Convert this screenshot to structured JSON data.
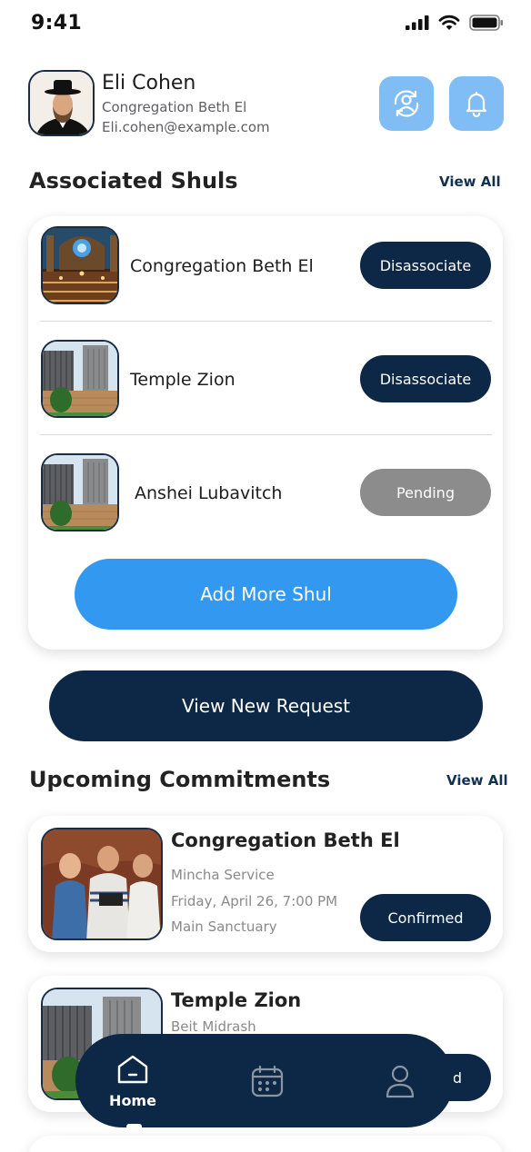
{
  "status_bar": {
    "time": "9:41"
  },
  "profile": {
    "name": "Eli Cohen",
    "shul": "Congregation Beth El",
    "email": "Eli.cohen@example.com"
  },
  "associated_shuls": {
    "title": "Associated Shuls",
    "view_all": "View All",
    "items": [
      {
        "name": "Congregation Beth El",
        "action": "Disassociate"
      },
      {
        "name": "Temple Zion",
        "action": "Disassociate"
      },
      {
        "name": "Anshei Lubavitch",
        "action": "Pending"
      }
    ],
    "add_button": "Add More Shul"
  },
  "view_new_request": "View New Request",
  "upcoming_commitments": {
    "title": "Upcoming Commitments",
    "view_all": "View All",
    "items": [
      {
        "shul": "Congregation Beth El",
        "service": "Mincha Service",
        "datetime": "Friday, April 26, 7:00 PM",
        "location": "Main Sanctuary",
        "status": "Confirmed"
      },
      {
        "shul": "Temple Zion",
        "service": "Beit Midrash",
        "status": "d"
      }
    ]
  },
  "bottom_nav": {
    "home_label": "Home",
    "items": [
      {
        "icon": "home-icon"
      },
      {
        "icon": "calendar-icon"
      },
      {
        "icon": "profile-icon"
      }
    ]
  },
  "colors": {
    "navy": "#0d2846",
    "accent_blue": "#3399f0",
    "light_blue": "#81bdf5",
    "pending_grey": "#8c8c8c"
  }
}
